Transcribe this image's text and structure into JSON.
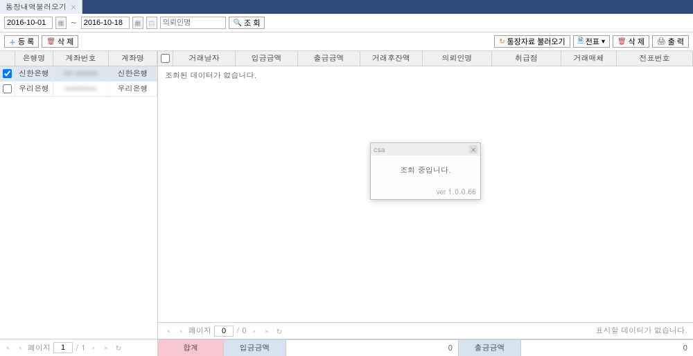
{
  "tab": {
    "title": "통장내역불러오기"
  },
  "toolbar": {
    "date_from": "2016-10-01",
    "date_to": "2016-10-18",
    "client_placeholder": "의뢰인명",
    "search_label": "조 회"
  },
  "toolbar2": {
    "register_label": "등 록",
    "delete_label": "삭 제",
    "load_label": "통장자료 불러오기",
    "receipt_label": "전표",
    "delete2_label": "삭 제",
    "print_label": "출 력"
  },
  "left_grid": {
    "headers": {
      "bank": "은행명",
      "accno": "계좌번호",
      "accname": "계좌명"
    },
    "rows": [
      {
        "checked": true,
        "bank": "신한은행",
        "accno": "••• ••••••••",
        "accname": "신한은행"
      },
      {
        "checked": false,
        "bank": "우리은행",
        "accno": "•••••••••••",
        "accname": "우리은행"
      }
    ]
  },
  "left_pager": {
    "page_label": "페이지",
    "page": "1",
    "total": "/ 1"
  },
  "right_grid": {
    "headers": {
      "date": "거래날자",
      "in": "입금금액",
      "out": "출금금액",
      "after": "거래후잔액",
      "client": "의뢰인명",
      "branch": "취급점",
      "medium": "거래매체",
      "voucher": "전표번호"
    },
    "empty_text": "조회된 데이터가 없습니다."
  },
  "modal": {
    "title": "csa",
    "message": "조회 중입니다.",
    "version": "ver 1.0.0.66"
  },
  "right_pager": {
    "page_label": "페이지",
    "page": "0",
    "total": "/ 0",
    "empty_msg": "표시할 데이터가 없습니다."
  },
  "summary": {
    "total_label": "합계",
    "in_label": "입금금액",
    "in_val": "0",
    "out_label": "출금금액",
    "out_val": "0"
  }
}
